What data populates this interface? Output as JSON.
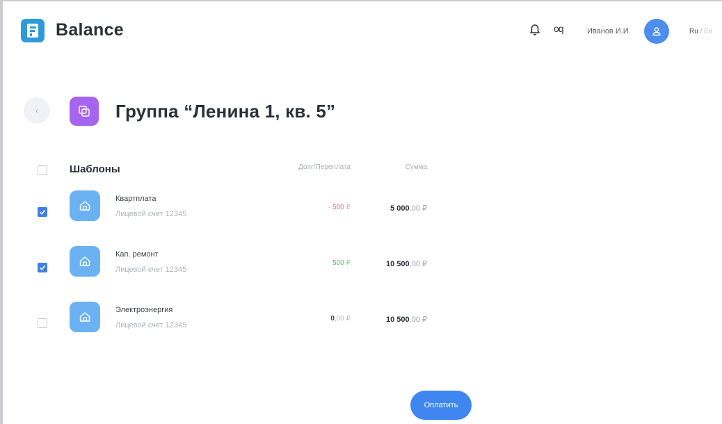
{
  "app": {
    "brand": "Balance",
    "logo_letter": "F",
    "accent": "#3f86f0"
  },
  "header": {
    "notifications_icon": "bell-icon",
    "operations_label": "oq",
    "user_name": "Иванов И.И.",
    "avatar_icon": "user-icon",
    "lang_active": "Ru",
    "lang_separator": "/",
    "lang_inactive": "En"
  },
  "page": {
    "back_icon": "chevron-left-icon",
    "title": "Группа “Ленина 1, кв. 5”",
    "group_icon": "layers-icon"
  },
  "table": {
    "title": "Шаблоны",
    "col_debt": "Долг/Переплата",
    "col_sum": "Сумма",
    "select_all_checked": false,
    "rows": [
      {
        "name": "Квартплата",
        "account": "Лицевой счет 12345",
        "checked": true,
        "debt_value": "- 500",
        "debt_currency": "₽",
        "debt_status": "negative",
        "sum_int": "5 000",
        "sum_dec": ",00 ₽",
        "icon": "house-icon"
      },
      {
        "name": "Кап. ремонт",
        "account": "Лицевой счет 12345",
        "checked": true,
        "debt_value": "500",
        "debt_currency": "₽",
        "debt_status": "positive",
        "sum_int": "10 500",
        "sum_dec": ",00 ₽",
        "icon": "house-icon"
      },
      {
        "name": "Электроэнергия",
        "account": "Лицевой счет 12345",
        "checked": false,
        "debt_value": "0",
        "debt_currency": ",00 ₽",
        "debt_status": "zero",
        "sum_int": "10 500",
        "sum_dec": ",00 ₽",
        "icon": "house-icon"
      }
    ]
  },
  "actions": {
    "pay_label": "Оплатить"
  }
}
